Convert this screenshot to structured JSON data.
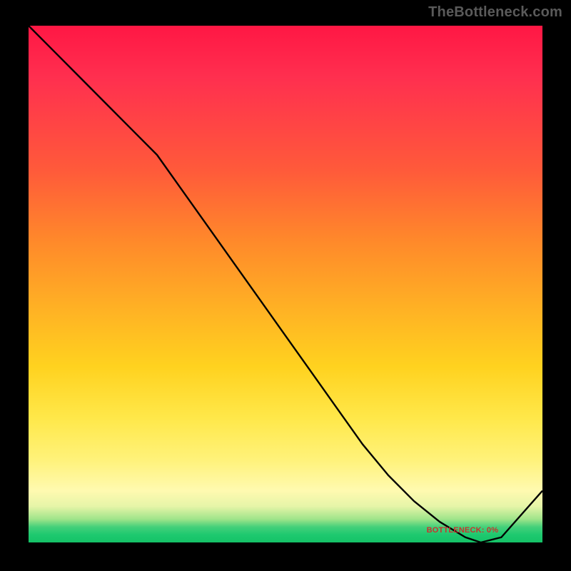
{
  "attribution": "TheBottleneck.com",
  "bottom_label": "BOTTLENECK: 0%",
  "colors": {
    "frame": "#000000",
    "attribution_text": "#5a5a5a",
    "curve": "#000000",
    "bottom_label": "#c8332f"
  },
  "chart_data": {
    "type": "line",
    "title": "",
    "xlabel": "",
    "ylabel": "",
    "xlim": [
      0,
      100
    ],
    "ylim": [
      0,
      100
    ],
    "x": [
      0,
      5,
      10,
      15,
      20,
      25,
      30,
      35,
      40,
      45,
      50,
      55,
      60,
      65,
      70,
      75,
      80,
      85,
      88,
      92,
      100
    ],
    "values": [
      100,
      95,
      90,
      85,
      80,
      75,
      68,
      61,
      54,
      47,
      40,
      33,
      26,
      19,
      13,
      8,
      4,
      1,
      0,
      1,
      10
    ],
    "minimum_x": 88,
    "minimum_y": 0,
    "annotation": {
      "text": "BOTTLENECK: 0%",
      "x": 83,
      "y": 1.5
    }
  }
}
